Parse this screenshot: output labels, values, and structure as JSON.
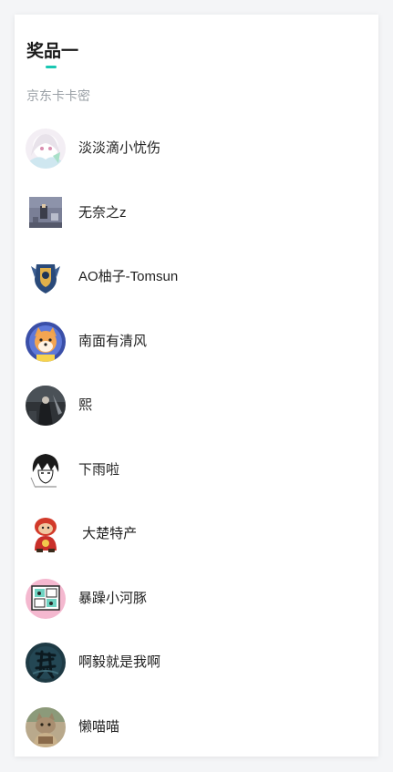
{
  "prize": {
    "title": "奖品一",
    "subtitle": "京东卡卡密",
    "accent_color": "#19c7b2"
  },
  "winners": [
    {
      "name": "淡淡滴小忧伤",
      "avatar_icon": "anime-girl-avatar"
    },
    {
      "name": "无奈之z",
      "avatar_icon": "pixel-art-avatar"
    },
    {
      "name": "AO柚子-Tomsun",
      "avatar_icon": "crest-avatar"
    },
    {
      "name": "南面有清风",
      "avatar_icon": "shiba-dog-avatar"
    },
    {
      "name": "熙",
      "avatar_icon": "dark-figure-avatar"
    },
    {
      "name": "下雨啦",
      "avatar_icon": "manga-boy-avatar"
    },
    {
      "name": " 大楚特产",
      "avatar_icon": "red-mascot-avatar"
    },
    {
      "name": "暴躁小河豚",
      "avatar_icon": "cartoon-frame-avatar"
    },
    {
      "name": "啊毅就是我啊",
      "avatar_icon": "dark-calligraphy-avatar"
    },
    {
      "name": "懒喵喵",
      "avatar_icon": "cat-photo-avatar"
    }
  ]
}
